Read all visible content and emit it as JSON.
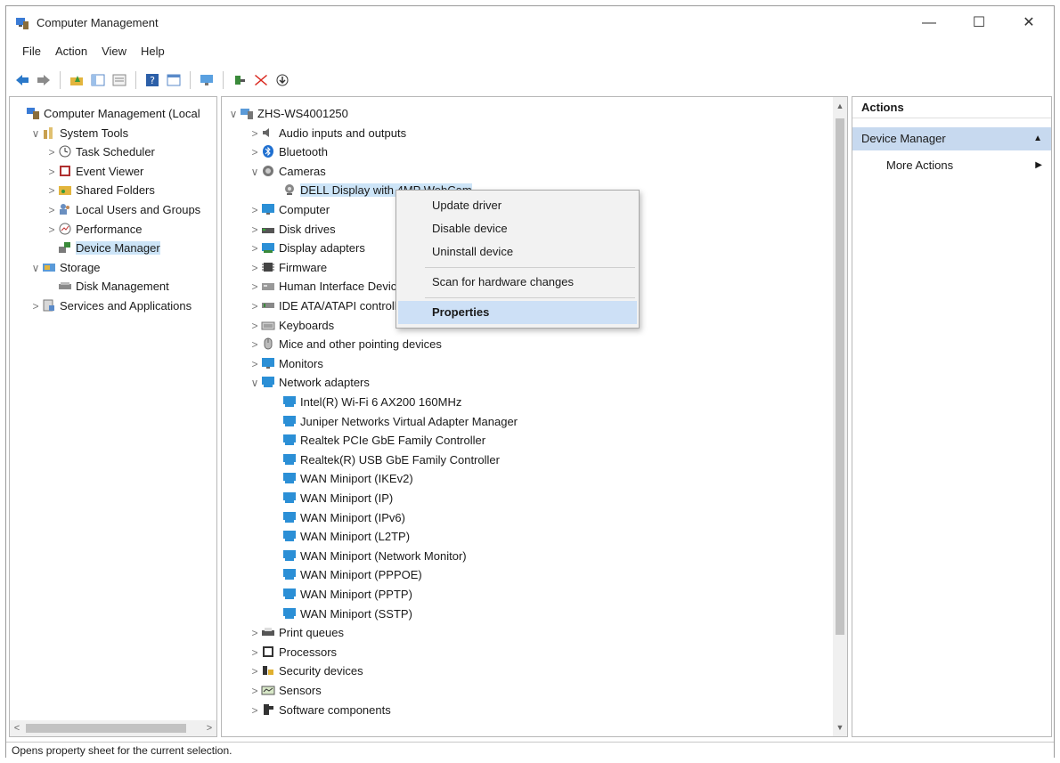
{
  "window": {
    "title": "Computer Management",
    "min": "—",
    "max": "☐",
    "close": "✕"
  },
  "menu": [
    "File",
    "Action",
    "View",
    "Help"
  ],
  "left_tree": [
    {
      "label": "Computer Management (Local",
      "chev": "",
      "indent": 0,
      "icon": "computer-management-icon"
    },
    {
      "label": "System Tools",
      "chev": "∨",
      "indent": 1,
      "icon": "tools-icon"
    },
    {
      "label": "Task Scheduler",
      "chev": ">",
      "indent": 2,
      "icon": "clock-icon"
    },
    {
      "label": "Event Viewer",
      "chev": ">",
      "indent": 2,
      "icon": "event-viewer-icon"
    },
    {
      "label": "Shared Folders",
      "chev": ">",
      "indent": 2,
      "icon": "shared-folder-icon"
    },
    {
      "label": "Local Users and Groups",
      "chev": ">",
      "indent": 2,
      "icon": "users-icon"
    },
    {
      "label": "Performance",
      "chev": ">",
      "indent": 2,
      "icon": "performance-icon"
    },
    {
      "label": "Device Manager",
      "chev": "",
      "indent": 2,
      "icon": "device-manager-icon",
      "selected": true
    },
    {
      "label": "Storage",
      "chev": "∨",
      "indent": 1,
      "icon": "storage-icon"
    },
    {
      "label": "Disk Management",
      "chev": "",
      "indent": 2,
      "icon": "disk-icon"
    },
    {
      "label": "Services and Applications",
      "chev": ">",
      "indent": 1,
      "icon": "services-icon"
    }
  ],
  "center_tree": [
    {
      "label": "ZHS-WS4001250",
      "chev": "∨",
      "indent": 0,
      "icon": "computer-icon"
    },
    {
      "label": "Audio inputs and outputs",
      "chev": ">",
      "indent": 1,
      "icon": "audio-icon"
    },
    {
      "label": "Bluetooth",
      "chev": ">",
      "indent": 1,
      "icon": "bluetooth-icon"
    },
    {
      "label": "Cameras",
      "chev": "∨",
      "indent": 1,
      "icon": "camera-icon"
    },
    {
      "label": "DELL Display with 4MP WebCam",
      "chev": "",
      "indent": 2,
      "icon": "webcam-icon",
      "selected": true
    },
    {
      "label": "Computer",
      "chev": ">",
      "indent": 1,
      "icon": "monitor-icon"
    },
    {
      "label": "Disk drives",
      "chev": ">",
      "indent": 1,
      "icon": "disk-drive-icon"
    },
    {
      "label": "Display adapters",
      "chev": ">",
      "indent": 1,
      "icon": "display-adapter-icon"
    },
    {
      "label": "Firmware",
      "chev": ">",
      "indent": 1,
      "icon": "firmware-icon"
    },
    {
      "label": "Human Interface Devices",
      "chev": ">",
      "indent": 1,
      "icon": "hid-icon"
    },
    {
      "label": "IDE ATA/ATAPI controllers",
      "chev": ">",
      "indent": 1,
      "icon": "ide-icon"
    },
    {
      "label": "Keyboards",
      "chev": ">",
      "indent": 1,
      "icon": "keyboard-icon"
    },
    {
      "label": "Mice and other pointing devices",
      "chev": ">",
      "indent": 1,
      "icon": "mouse-icon"
    },
    {
      "label": "Monitors",
      "chev": ">",
      "indent": 1,
      "icon": "monitor-icon"
    },
    {
      "label": "Network adapters",
      "chev": "∨",
      "indent": 1,
      "icon": "network-adapter-icon"
    },
    {
      "label": "Intel(R) Wi-Fi 6 AX200 160MHz",
      "chev": "",
      "indent": 2,
      "icon": "network-adapter-icon"
    },
    {
      "label": "Juniper Networks Virtual Adapter Manager",
      "chev": "",
      "indent": 2,
      "icon": "network-adapter-icon"
    },
    {
      "label": "Realtek PCIe GbE Family Controller",
      "chev": "",
      "indent": 2,
      "icon": "network-adapter-icon"
    },
    {
      "label": "Realtek(R) USB GbE Family Controller",
      "chev": "",
      "indent": 2,
      "icon": "network-adapter-icon"
    },
    {
      "label": "WAN Miniport (IKEv2)",
      "chev": "",
      "indent": 2,
      "icon": "network-adapter-icon"
    },
    {
      "label": "WAN Miniport (IP)",
      "chev": "",
      "indent": 2,
      "icon": "network-adapter-icon"
    },
    {
      "label": "WAN Miniport (IPv6)",
      "chev": "",
      "indent": 2,
      "icon": "network-adapter-icon"
    },
    {
      "label": "WAN Miniport (L2TP)",
      "chev": "",
      "indent": 2,
      "icon": "network-adapter-icon"
    },
    {
      "label": "WAN Miniport (Network Monitor)",
      "chev": "",
      "indent": 2,
      "icon": "network-adapter-icon"
    },
    {
      "label": "WAN Miniport (PPPOE)",
      "chev": "",
      "indent": 2,
      "icon": "network-adapter-icon"
    },
    {
      "label": "WAN Miniport (PPTP)",
      "chev": "",
      "indent": 2,
      "icon": "network-adapter-icon"
    },
    {
      "label": "WAN Miniport (SSTP)",
      "chev": "",
      "indent": 2,
      "icon": "network-adapter-icon"
    },
    {
      "label": "Print queues",
      "chev": ">",
      "indent": 1,
      "icon": "printer-icon"
    },
    {
      "label": "Processors",
      "chev": ">",
      "indent": 1,
      "icon": "processor-icon"
    },
    {
      "label": "Security devices",
      "chev": ">",
      "indent": 1,
      "icon": "security-icon"
    },
    {
      "label": "Sensors",
      "chev": ">",
      "indent": 1,
      "icon": "sensor-icon"
    },
    {
      "label": "Software components",
      "chev": ">",
      "indent": 1,
      "icon": "software-component-icon"
    }
  ],
  "context_menu": {
    "items": [
      "Update driver",
      "Disable device",
      "Uninstall device",
      "Scan for hardware changes",
      "Properties"
    ],
    "highlighted": "Properties"
  },
  "actions": {
    "header": "Actions",
    "section": "Device Manager",
    "more": "More Actions",
    "section_arrow": "▲",
    "more_arrow": "▶"
  },
  "status": "Opens property sheet for the current selection.",
  "colors": {
    "selection": "#cce4f7",
    "actions_section": "#c7d9ef",
    "menu_highlight": "#cde0f6",
    "close_red": "#d9261c",
    "adapter_blue": "#2b8fd6"
  }
}
